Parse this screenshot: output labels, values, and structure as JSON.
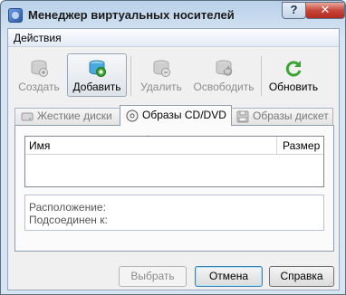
{
  "window": {
    "title": "Менеджер виртуальных носителей",
    "help_label": "?",
    "close_label": "✕"
  },
  "menu": {
    "items": [
      {
        "label": "Действия"
      }
    ]
  },
  "toolbar": {
    "buttons": [
      {
        "label": "Создать",
        "icon": "disk-new-icon",
        "enabled": false,
        "pressed": false
      },
      {
        "label": "Добавить",
        "icon": "disk-add-icon",
        "enabled": true,
        "pressed": true
      },
      {
        "label": "Удалить",
        "icon": "disk-remove-icon",
        "enabled": false,
        "pressed": false
      },
      {
        "label": "Освободить",
        "icon": "disk-release-icon",
        "enabled": false,
        "pressed": false
      },
      {
        "label": "Обновить",
        "icon": "refresh-icon",
        "enabled": true,
        "pressed": false
      }
    ]
  },
  "tabs": [
    {
      "label": "Жесткие диски",
      "icon": "hard-disk-icon",
      "active": false
    },
    {
      "label": "Образы CD/DVD",
      "icon": "cd-dvd-icon",
      "active": true
    },
    {
      "label": "Образы дискет",
      "icon": "floppy-icon",
      "active": false
    }
  ],
  "list": {
    "columns": [
      {
        "label": "Имя"
      },
      {
        "label": "Размер"
      }
    ],
    "sort_indicator": "ˆ",
    "rows": []
  },
  "details": {
    "location_label": "Расположение:",
    "attached_label": "Подсоединен к:"
  },
  "buttons": {
    "select": "Выбрать",
    "cancel": "Отмена",
    "help": "Справка"
  },
  "colors": {
    "title_bar": "#b9d1ea",
    "close_button": "#c8453a",
    "accent_green": "#3aa533"
  }
}
